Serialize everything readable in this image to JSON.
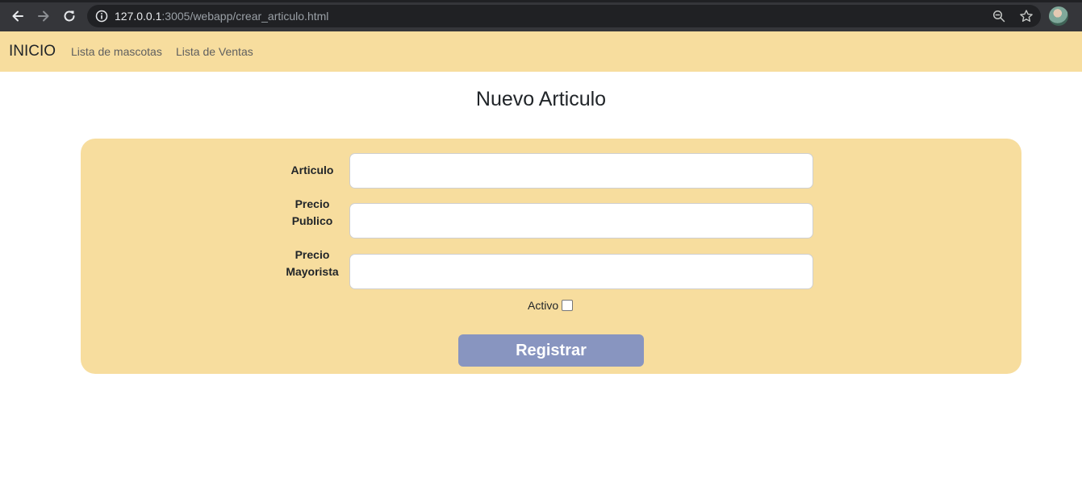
{
  "browser": {
    "url_host": "127.0.0.1",
    "url_rest": ":3005/webapp/crear_articulo.html",
    "icons": [
      "back-arrow-icon",
      "forward-arrow-icon",
      "reload-icon",
      "info-icon",
      "zoom-icon",
      "star-icon"
    ]
  },
  "navbar": {
    "brand": "INICIO",
    "links": [
      "Lista de mascotas",
      "Lista de Ventas"
    ]
  },
  "page": {
    "title": "Nuevo Articulo"
  },
  "form": {
    "fields": [
      {
        "label_line1": "Articulo",
        "label_line2": "",
        "value": "",
        "placeholder": ""
      },
      {
        "label_line1": "Precio",
        "label_line2": "Publico",
        "value": "",
        "placeholder": ""
      },
      {
        "label_line1": "Precio",
        "label_line2": "Mayorista",
        "value": "",
        "placeholder": ""
      }
    ],
    "activo_label": "Activo",
    "activo_checked": false,
    "submit_label": "Registrar"
  },
  "colors": {
    "navbar_bg": "#f7dd9e",
    "card_bg": "#f7dd9e",
    "button_bg": "#8895c0",
    "chrome_bg": "#35363a"
  }
}
